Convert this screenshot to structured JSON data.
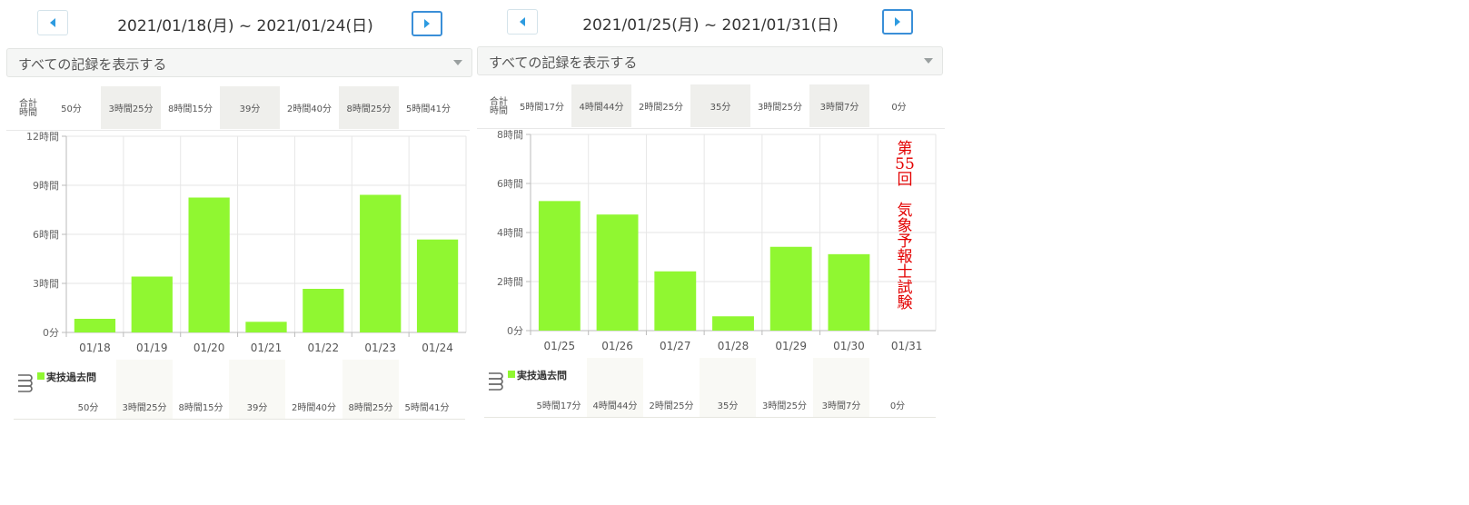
{
  "colors": {
    "bar": "#90f731",
    "accent": "#2d9be0",
    "annotation": "#e30000"
  },
  "panels": [
    {
      "prev_icon": "caret-left-icon",
      "next_icon": "caret-right-icon",
      "date_range": "2021/01/18(月) ~ 2021/01/24(日)",
      "filter_label": "すべての記録を表示する",
      "totals_label": [
        "合計",
        "時間"
      ],
      "totals": [
        "50分",
        "3時間25分",
        "8時間15分",
        "39分",
        "2時間40分",
        "8時間25分",
        "5時間41分"
      ],
      "legend_label": "実技過去問",
      "legend_values": [
        "50分",
        "3時間25分",
        "8時間15分",
        "39分",
        "2時間40分",
        "8時間25分",
        "5時間41分"
      ]
    },
    {
      "prev_icon": "caret-left-icon",
      "next_icon": "caret-right-icon",
      "date_range": "2021/01/25(月) ~ 2021/01/31(日)",
      "filter_label": "すべての記録を表示する",
      "totals_label": [
        "合計",
        "時間"
      ],
      "totals": [
        "5時間17分",
        "4時間44分",
        "2時間25分",
        "35分",
        "3時間25分",
        "3時間7分",
        "0分"
      ],
      "legend_label": "実技過去問",
      "legend_values": [
        "5時間17分",
        "4時間44分",
        "2時間25分",
        "35分",
        "3時間25分",
        "3時間7分",
        "0分"
      ],
      "annotation": [
        "第",
        "55",
        "回",
        "",
        "気",
        "象",
        "予",
        "報",
        "士",
        "試",
        "験"
      ]
    }
  ],
  "chart_data": [
    {
      "type": "bar",
      "categories": [
        "01/18",
        "01/19",
        "01/20",
        "01/21",
        "01/22",
        "01/23",
        "01/24"
      ],
      "values_minutes": [
        50,
        205,
        495,
        39,
        160,
        505,
        341
      ],
      "ylim": [
        0,
        720
      ],
      "yticks": [
        0,
        180,
        360,
        540,
        720
      ],
      "ytick_labels": [
        "0分",
        "3時間",
        "6時間",
        "9時間",
        "12時間"
      ],
      "series": [
        {
          "name": "実技過去問",
          "values": [
            50,
            205,
            495,
            39,
            160,
            505,
            341
          ]
        }
      ],
      "grid": true
    },
    {
      "type": "bar",
      "categories": [
        "01/25",
        "01/26",
        "01/27",
        "01/28",
        "01/29",
        "01/30",
        "01/31"
      ],
      "values_minutes": [
        317,
        284,
        145,
        35,
        205,
        187,
        0
      ],
      "ylim": [
        0,
        480
      ],
      "yticks": [
        0,
        120,
        240,
        360,
        480
      ],
      "ytick_labels": [
        "0分",
        "2時間",
        "4時間",
        "6時間",
        "8時間"
      ],
      "series": [
        {
          "name": "実技過去問",
          "values": [
            317,
            284,
            145,
            35,
            205,
            187,
            0
          ]
        }
      ],
      "grid": true
    }
  ]
}
